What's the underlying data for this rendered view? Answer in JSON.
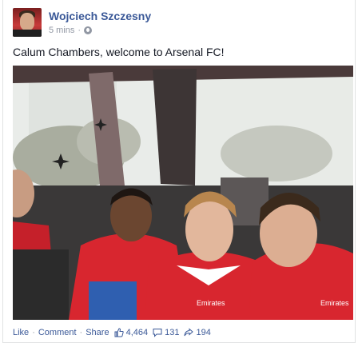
{
  "post": {
    "author": "Wojciech Szczesny",
    "time": "5 mins",
    "time_separator": "·",
    "text": "Calum Chambers, welcome to Arsenal FC!"
  },
  "actions": {
    "like": "Like",
    "comment": "Comment",
    "share": "Share",
    "separator": "·",
    "likes_count": "4,464",
    "comments_count": "131",
    "shares_count": "194"
  },
  "photo": {
    "jersey_text_1": "Emirates",
    "jersey_text_2": "Emirates"
  },
  "colors": {
    "link": "#3b5998",
    "meta": "#9197a3",
    "jersey_red": "#d8262f"
  },
  "icons": {
    "avatar": "profile-photo",
    "audience": "globe-icon",
    "likes": "thumbs-up-icon",
    "comments": "comment-bubble-icon",
    "shares": "share-arrow-icon"
  }
}
